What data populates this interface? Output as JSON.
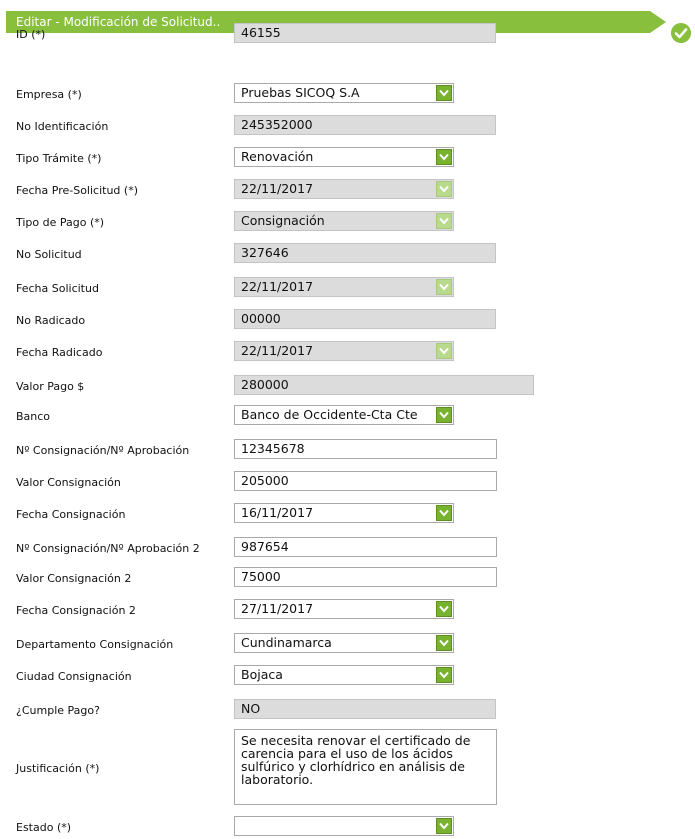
{
  "header": {
    "title": "Editar - Modificación de Solicitud.."
  },
  "icons": {
    "ok": "check-circle-icon",
    "dropdown": "chevron-down-icon"
  },
  "colors": {
    "accent": "#88bf3c",
    "readonly_field": "#dcdcdc"
  },
  "form": {
    "id": {
      "label": "ID (*)",
      "value": "46155"
    },
    "empresa": {
      "label": "Empresa (*)",
      "value": "Pruebas SICOQ S.A"
    },
    "no_identificacion": {
      "label": "No Identificación",
      "value": "245352000"
    },
    "tipo_tramite": {
      "label": "Tipo Trámite (*)",
      "value": "Renovación"
    },
    "fecha_pre_solicitud": {
      "label": "Fecha Pre-Solicitud (*)",
      "value": "22/11/2017"
    },
    "tipo_pago": {
      "label": "Tipo de Pago (*)",
      "value": "Consignación"
    },
    "no_solicitud": {
      "label": "No Solicitud",
      "value": "327646"
    },
    "fecha_solicitud": {
      "label": "Fecha Solicitud",
      "value": "22/11/2017"
    },
    "no_radicado": {
      "label": "No Radicado",
      "value": "00000"
    },
    "fecha_radicado": {
      "label": "Fecha Radicado",
      "value": "22/11/2017"
    },
    "valor_pago": {
      "label": "Valor Pago $",
      "value": "280000"
    },
    "banco": {
      "label": "Banco",
      "value": "Banco de Occidente-Cta Cte"
    },
    "consignacion_1": {
      "label": "Nº Consignación/Nº Aprobación",
      "value": "12345678"
    },
    "valor_consignacion_1": {
      "label": "Valor Consignación",
      "value": "205000"
    },
    "fecha_consignacion_1": {
      "label": "Fecha Consignación",
      "value": "16/11/2017"
    },
    "consignacion_2": {
      "label": "Nº Consignación/Nº Aprobación 2",
      "value": "987654"
    },
    "valor_consignacion_2": {
      "label": "Valor Consignación 2",
      "value": "75000"
    },
    "fecha_consignacion_2": {
      "label": "Fecha Consignación 2",
      "value": "27/11/2017"
    },
    "departamento": {
      "label": "Departamento Consignación",
      "value": "Cundinamarca"
    },
    "ciudad": {
      "label": "Ciudad Consignación",
      "value": "Bojaca"
    },
    "cumple_pago": {
      "label": "¿Cumple Pago?",
      "value": "NO"
    },
    "justificacion": {
      "label": "Justificación (*)",
      "value": "Se necesita renovar el certificado de carencia para el uso de los ácidos sulfúrico y clorhídrico en análisis de laboratorio."
    },
    "estado": {
      "label": "Estado (*)",
      "value": ""
    }
  }
}
